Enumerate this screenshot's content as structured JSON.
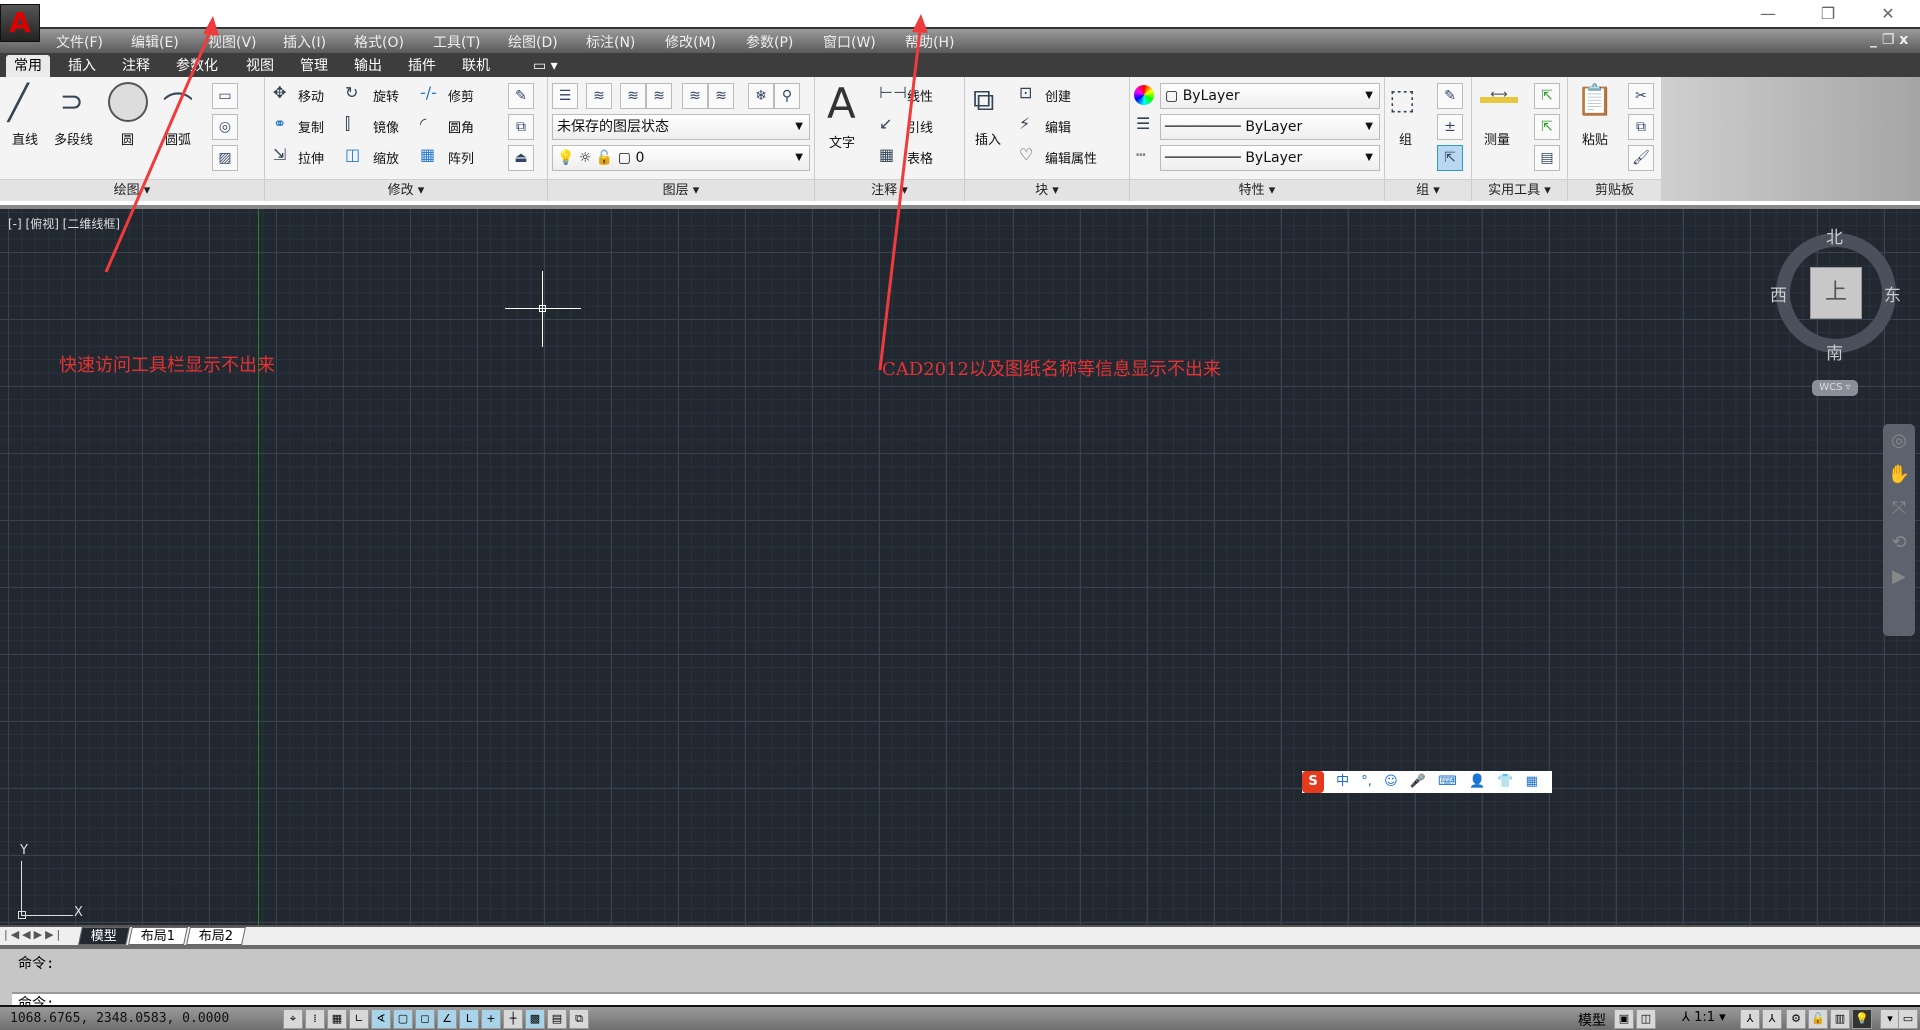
{
  "menubar": {
    "items": [
      "文件(F)",
      "编辑(E)",
      "视图(V)",
      "插入(I)",
      "格式(O)",
      "工具(T)",
      "绘图(D)",
      "标注(N)",
      "修改(M)",
      "参数(P)",
      "窗口(W)",
      "帮助(H)"
    ]
  },
  "ribbon_tabs": [
    "常用",
    "插入",
    "注释",
    "参数化",
    "视图",
    "管理",
    "输出",
    "插件",
    "联机"
  ],
  "active_tab": "常用",
  "panels": {
    "draw": {
      "title": "绘图",
      "line": "直线",
      "polyline": "多段线",
      "circle": "圆",
      "arc": "圆弧"
    },
    "modify": {
      "title": "修改",
      "move": "移动",
      "rotate": "旋转",
      "trim": "修剪",
      "copy": "复制",
      "mirror": "镜像",
      "fillet": "圆角",
      "stretch": "拉伸",
      "scale": "缩放",
      "array": "阵列"
    },
    "layers": {
      "title": "图层",
      "layer_state": "未保存的图层状态",
      "current_layer": "0"
    },
    "annotation": {
      "title": "注释",
      "text": "文字",
      "linear": "线性",
      "leader": "引线",
      "table": "表格"
    },
    "block": {
      "title": "块",
      "insert": "插入",
      "create": "创建",
      "edit": "编辑",
      "edit_attributes": "编辑属性"
    },
    "properties": {
      "title": "特性",
      "color": "ByLayer",
      "lineweight": "ByLayer",
      "linetype": "ByLayer"
    },
    "groups": {
      "title": "组",
      "group": "组"
    },
    "utilities": {
      "title": "实用工具",
      "measure": "测量"
    },
    "clipboard": {
      "title": "剪贴板",
      "paste": "粘贴"
    }
  },
  "viewport": {
    "label": "[-] [俯视] [二维线框]",
    "annotation_1": "快速访问工具栏显示不出来",
    "annotation_2": "CAD2012以及图纸名称等信息显示不出来",
    "viewcube": {
      "north": "北",
      "south": "南",
      "east": "东",
      "west": "西",
      "top": "上",
      "wcs": "WCS"
    },
    "ucs": {
      "x": "X",
      "y": "Y"
    },
    "ime": {
      "items": [
        "中",
        "°,",
        "☺",
        "🎤",
        "⌨",
        "👤",
        "👕",
        "▦"
      ]
    }
  },
  "layout_tabs": [
    "模型",
    "布局1",
    "布局2"
  ],
  "command": {
    "history": "命令:",
    "prompt": "命令:"
  },
  "status": {
    "coordinates": "1068.6765,  2348.0583,  0.0000",
    "model": "模型",
    "annotation_scale": "1:1"
  },
  "colors": {
    "canvas": "#212830",
    "annotation": "#e53333",
    "ribbon_bg": "#f3f3f3"
  }
}
